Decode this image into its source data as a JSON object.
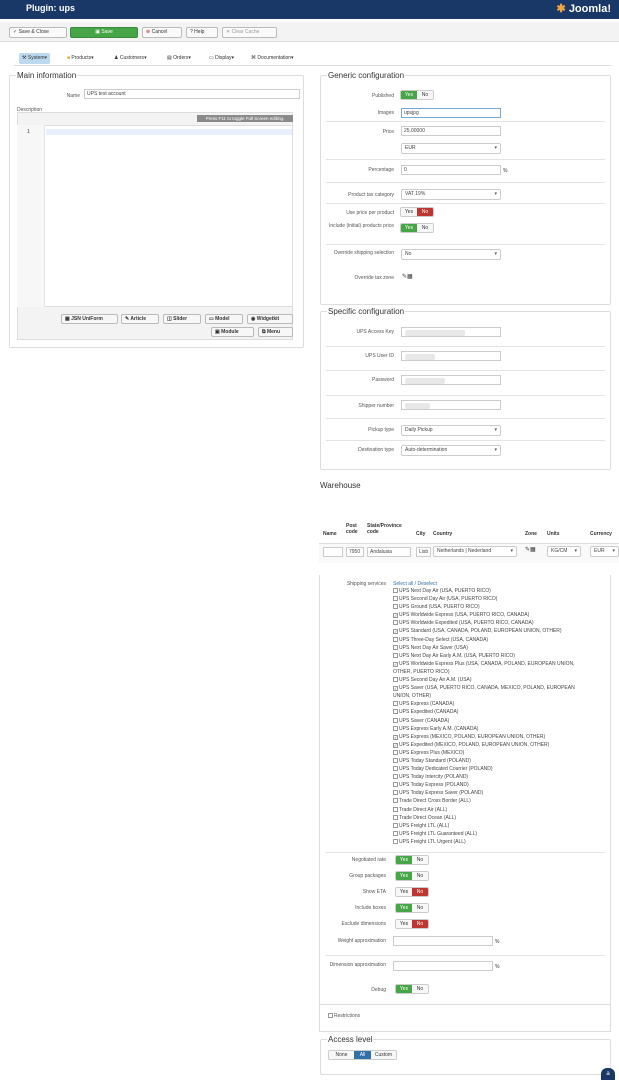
{
  "header": {
    "title": "Plugin: ups",
    "logo_text": "Joomla!"
  },
  "toolbar": {
    "save_close": "Save & Close",
    "save": "Save",
    "cancel": "Cancel",
    "help": "Help",
    "clear_cache": "Clear Cache"
  },
  "submenu": [
    "System",
    "Products",
    "Customers",
    "Orders",
    "Display",
    "Documentation"
  ],
  "main_info": {
    "legend": "Main information",
    "name_label": "Name",
    "name_value": "UPS test account",
    "desc_label": "Description",
    "editor_hint": "Press F11 to toggle Full Screen editing.",
    "line_no": "1",
    "buttons": [
      "JSN UniForm",
      "Article",
      "Slider",
      "Model",
      "Widgetkit",
      "Module",
      "Menu"
    ]
  },
  "generic": {
    "legend": "Generic configuration",
    "published_label": "Published",
    "images_label": "Images",
    "images_value": "upsjpg",
    "price_label": "Price",
    "price_value": "25.00000",
    "currency_value": "EUR",
    "percentage_label": "Percentage",
    "percentage_value": "0",
    "percentage_unit": "%",
    "tax_label": "Product tax category",
    "tax_value": "VAT 19%",
    "per_product_label": "Use price per product",
    "include_label": "Include (initial) products price",
    "override_label": "Override shipping selection",
    "override_value": "No",
    "override_zone_label": "Override tax zone",
    "yes": "Yes",
    "no": "No"
  },
  "specific": {
    "legend": "Specific configuration",
    "access_key_label": "UPS Access Key",
    "user_id_label": "UPS User ID",
    "password_label": "Password",
    "shipper_label": "Shipper number",
    "pickup_label": "Pickup type",
    "pickup_value": "Daily Pickup",
    "dest_label": "Destination type",
    "dest_value": "Auto-determination"
  },
  "warehouse": {
    "title": "Warehouse",
    "headers": [
      "Name",
      "Post code",
      "State/Province code",
      "City",
      "Country",
      "Zone",
      "Units",
      "Currency"
    ],
    "row": [
      "",
      "7950",
      "Andalusia",
      "Lisb",
      "Netherlands | Nederland",
      "",
      "KG/CM",
      "EUR"
    ]
  },
  "services": {
    "label": "Shipping services",
    "select_all": "Select all",
    "deselect": "Deselect",
    "items": [
      {
        "t": "UPS Next Day Air (USA, PUERTO RICO)",
        "c": false
      },
      {
        "t": "UPS Second Day Air (USA, PUERTO RICO)",
        "c": false
      },
      {
        "t": "UPS Ground (USA, PUERTO RICO)",
        "c": false
      },
      {
        "t": "UPS Worldwide Express (USA, PUERTO RICO, CANADA)",
        "c": true
      },
      {
        "t": "UPS Worldwide Expedited (USA, PUERTO RICO, CANADA)",
        "c": false
      },
      {
        "t": "UPS Standard (USA, CANADA, POLAND, EUROPEAN UNION, OTHER)",
        "c": true
      },
      {
        "t": "UPS Three-Day Select (USA, CANADA)",
        "c": false
      },
      {
        "t": "UPS Next Day Air Saver (USA)",
        "c": false
      },
      {
        "t": "UPS Next Day Air Early A.M. (USA, PUERTO RICO)",
        "c": false
      },
      {
        "t": "UPS Worldwide Express Plus (USA, CANADA, POLAND, EUROPEAN UNION,",
        "c": true
      },
      {
        "t": "OTHER, PUERTO RICO)",
        "c": null
      },
      {
        "t": "UPS Second Day Air A.M. (USA)",
        "c": false
      },
      {
        "t": "UPS Saver (USA, PUERTO RICO, CANADA, MEXICO, POLAND, EUROPEAN",
        "c": true
      },
      {
        "t": "UNION, OTHER)",
        "c": null
      },
      {
        "t": "UPS Express (CANADA)",
        "c": false
      },
      {
        "t": "UPS Expedited (CANADA)",
        "c": false
      },
      {
        "t": "UPS Saver (CANADA)",
        "c": false
      },
      {
        "t": "UPS Express Early A.M. (CANADA)",
        "c": false
      },
      {
        "t": "UPS Express (MEXICO, POLAND, EUROPEAN UNION, OTHER)",
        "c": true
      },
      {
        "t": "UPS Expedited (MEXICO, POLAND, EUROPEAN UNION, OTHER)",
        "c": true
      },
      {
        "t": "UPS Express Plus (MEXICO)",
        "c": false
      },
      {
        "t": "UPS Today Standard (POLAND)",
        "c": false
      },
      {
        "t": "UPS Today Dedicated Courrier (POLAND)",
        "c": false
      },
      {
        "t": "UPS Today Intercity (POLAND)",
        "c": false
      },
      {
        "t": "UPS Today Express (POLAND)",
        "c": false
      },
      {
        "t": "UPS Today Express Saver (POLAND)",
        "c": false
      },
      {
        "t": "Trade Direct Cross Border (ALL)",
        "c": false
      },
      {
        "t": "Trade Direct Air (ALL)",
        "c": false
      },
      {
        "t": "Trade Direct Ocean (ALL)",
        "c": false
      },
      {
        "t": "UPS Freight LTL (ALL)",
        "c": false
      },
      {
        "t": "UPS Freight LTL Guaranteed (ALL)",
        "c": false
      },
      {
        "t": "UPS Freight LTL Urgent (ALL)",
        "c": false
      }
    ]
  },
  "options": {
    "negotiated": "Negotiated rate",
    "group": "Group packages",
    "eta": "Show ETA",
    "boxes": "Include boxes",
    "exclude_dim": "Exclude dimensions",
    "weight": "Weight approximation",
    "dimension": "Dimension approximation",
    "debug": "Debug",
    "pct": "%"
  },
  "checkbox_label": "Restrictions",
  "access": {
    "legend": "Access level",
    "options": [
      "None",
      "All",
      "Custom"
    ]
  }
}
